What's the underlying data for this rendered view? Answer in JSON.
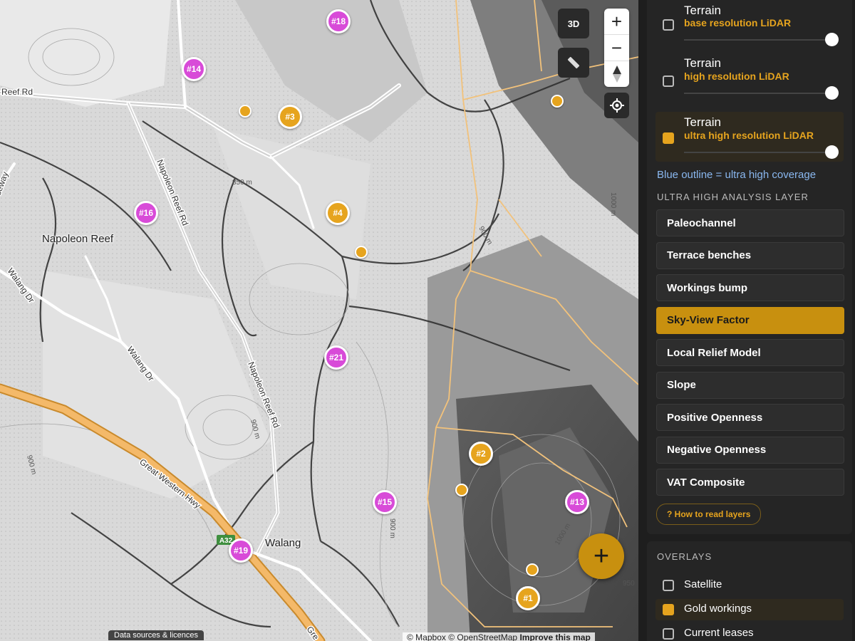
{
  "map": {
    "controls": {
      "three_d": "3D",
      "zoom_in": "+",
      "zoom_out": "−",
      "compass": "▲"
    },
    "place_labels": {
      "napoleon_reef": "Napoleon Reef",
      "walang": "Walang"
    },
    "road_labels": {
      "reef_rd": "Reef Rd",
      "napoleon_reef_rd_north": "Napoleon Reef Rd",
      "napoleon_reef_rd_south": "Napoleon Reef Rd",
      "walang_dr_west": "Walang Dr",
      "walang_dr_east": "Walang Dr",
      "great_western_hwy": "Great Western Hwy",
      "seway": "seway",
      "gre": "Gre",
      "a32": "A32"
    },
    "contour_labels": {
      "c850": "850 m",
      "c900a": "900 m",
      "c900b": "900 m",
      "c900c": "900 m",
      "c900d": "900 m",
      "c950": "950 m",
      "c950b": "950",
      "c1000a": "1000 m",
      "c1000b": "1000 m"
    },
    "markers": [
      {
        "label": "#18",
        "style": "pink"
      },
      {
        "label": "#14",
        "style": "pink"
      },
      {
        "label": "#3",
        "style": "gold"
      },
      {
        "label": "#16",
        "style": "pink"
      },
      {
        "label": "#4",
        "style": "gold"
      },
      {
        "label": "#21",
        "style": "pink"
      },
      {
        "label": "#2",
        "style": "gold"
      },
      {
        "label": "#15",
        "style": "pink"
      },
      {
        "label": "#13",
        "style": "pink"
      },
      {
        "label": "#19",
        "style": "pink"
      },
      {
        "label": "#1",
        "style": "gold"
      }
    ],
    "fab_label": "+",
    "attribution_button": "Data sources & licences",
    "credit": {
      "mapbox": "© Mapbox",
      "osm": "© OpenStreetMap",
      "improve": "Improve this map"
    }
  },
  "panel": {
    "terrain_layers": [
      {
        "title": "Terrain",
        "subtitle": "base resolution LiDAR",
        "checked": false
      },
      {
        "title": "Terrain",
        "subtitle": "high resolution LiDAR",
        "checked": false
      },
      {
        "title": "Terrain",
        "subtitle": "ultra high resolution LiDAR",
        "checked": true
      }
    ],
    "coverage_note": "Blue outline = ultra high coverage",
    "analysis_heading": "ULTRA HIGH ANALYSIS LAYER",
    "analysis_layers": [
      {
        "label": "Paleochannel",
        "active": false
      },
      {
        "label": "Terrace benches",
        "active": false
      },
      {
        "label": "Workings bump",
        "active": false
      },
      {
        "label": "Sky-View Factor",
        "active": true
      },
      {
        "label": "Local Relief Model",
        "active": false
      },
      {
        "label": "Slope",
        "active": false
      },
      {
        "label": "Positive Openness",
        "active": false
      },
      {
        "label": "Negative Openness",
        "active": false
      },
      {
        "label": "VAT Composite",
        "active": false
      }
    ],
    "how_to": "? How to read layers",
    "overlays_heading": "OVERLAYS",
    "overlays": [
      {
        "label": "Satellite",
        "checked": false
      },
      {
        "label": "Gold workings",
        "checked": true
      },
      {
        "label": "Current leases",
        "checked": false
      }
    ],
    "colors": {
      "accent": "#e6a41e",
      "accent_dark": "#c8900f",
      "pink_marker": "#d84bd8",
      "note_blue": "#8ab8f0"
    }
  }
}
